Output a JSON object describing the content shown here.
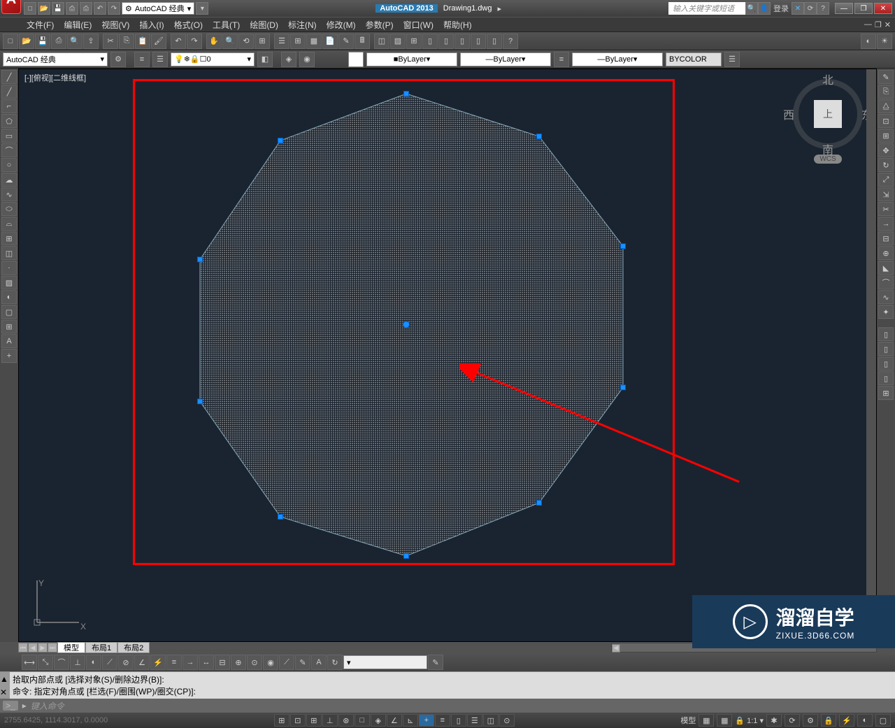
{
  "title": {
    "app": "AutoCAD 2013",
    "file": "Drawing1.dwg",
    "workspace_qat": "AutoCAD 经典",
    "search_placeholder": "输入关键字或短语",
    "login": "登录"
  },
  "menu": {
    "file": "文件(F)",
    "edit": "编辑(E)",
    "view": "视图(V)",
    "insert": "插入(I)",
    "format": "格式(O)",
    "tools": "工具(T)",
    "draw": "绘图(D)",
    "dimension": "标注(N)",
    "modify": "修改(M)",
    "parametric": "参数(P)",
    "window": "窗口(W)",
    "help": "帮助(H)"
  },
  "props": {
    "workspace": "AutoCAD 经典",
    "layer_value": "0",
    "color": "ByLayer",
    "linetype": "ByLayer",
    "lineweight": "ByLayer",
    "plotstyle": "BYCOLOR"
  },
  "viewport": {
    "label": "[-][俯视][二维线框]"
  },
  "navcube": {
    "north": "北",
    "south": "南",
    "east": "东",
    "west": "西",
    "top": "上",
    "wcs": "WCS"
  },
  "ucs": {
    "x": "X",
    "y": "Y"
  },
  "tabs": {
    "model": "模型",
    "layout1": "布局1",
    "layout2": "布局2"
  },
  "cmd": {
    "hist1": "拾取内部点或 [选择对象(S)/删除边界(B)]:",
    "hist2": "命令: 指定对角点或 [栏选(F)/圈围(WP)/圈交(CP)]:",
    "prompt": "键入命令"
  },
  "status": {
    "coords": "2755.6425, 1114.3017, 0.0000",
    "model": "模型",
    "scale": "1:1"
  },
  "watermark": {
    "title": "溜溜自学",
    "sub": "ZIXUE.3D66.COM"
  }
}
